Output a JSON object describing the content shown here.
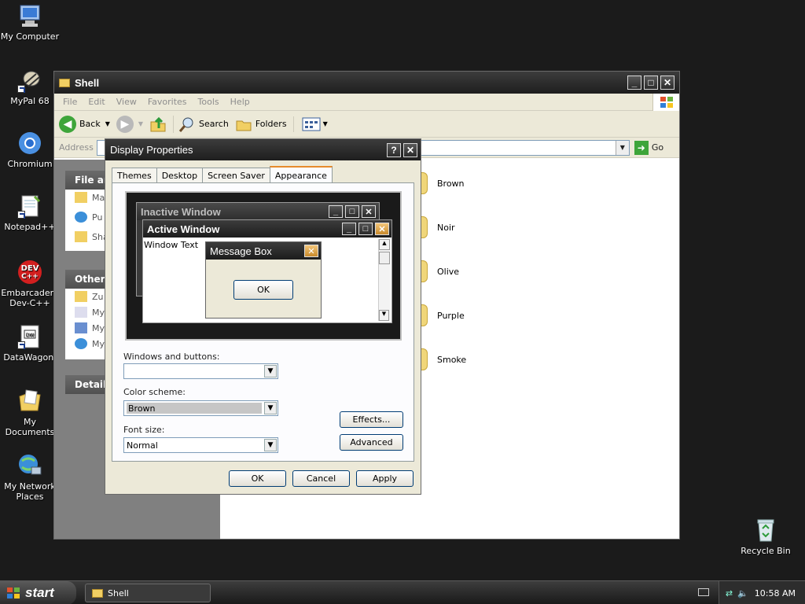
{
  "desktop": {
    "icons": [
      {
        "label": "My Computer"
      },
      {
        "label": "MyPal 68"
      },
      {
        "label": "Chromium"
      },
      {
        "label": "Notepad++"
      },
      {
        "label": "Embarcadero Dev-C++"
      },
      {
        "label": "DataWagon."
      },
      {
        "label": "My Documents"
      },
      {
        "label": "My Network Places"
      },
      {
        "label": "Recycle Bin"
      }
    ]
  },
  "shell": {
    "title": "Shell",
    "menu": [
      "File",
      "Edit",
      "View",
      "Favorites",
      "Tools",
      "Help"
    ],
    "toolbar": {
      "back": "Back",
      "search": "Search",
      "folders": "Folders"
    },
    "address_label": "Address",
    "go_label": "Go",
    "tasks": {
      "file_head": "File an",
      "file_rows": [
        "Ma",
        "Pu We",
        "Sha"
      ],
      "other_head": "Other",
      "other_rows": [
        "Zu",
        "My",
        "My",
        "My"
      ],
      "details_head": "Details"
    },
    "folders": [
      "Brown",
      "Noir",
      "Olive",
      "Purple",
      "Smoke"
    ]
  },
  "display_properties": {
    "title": "Display Properties",
    "tabs": [
      "Themes",
      "Desktop",
      "Screen Saver",
      "Appearance"
    ],
    "active_tab": "Appearance",
    "preview": {
      "inactive_title": "Inactive Window",
      "active_title": "Active Window",
      "window_text": "Window Text",
      "message_title": "Message Box",
      "message_ok": "OK"
    },
    "windows_buttons_label": "Windows and buttons:",
    "windows_buttons_value": "",
    "color_scheme_label": "Color scheme:",
    "color_scheme_value": "Brown",
    "font_size_label": "Font size:",
    "font_size_value": "Normal",
    "effects_button": "Effects...",
    "advanced_button": "Advanced",
    "ok_button": "OK",
    "cancel_button": "Cancel",
    "apply_button": "Apply"
  },
  "taskbar": {
    "start_label": "start",
    "task_shell": "Shell",
    "clock": "10:58 AM"
  },
  "colors": {
    "desktop_bg": "#1b1b1b",
    "accent_orange": "#e68b2c"
  }
}
